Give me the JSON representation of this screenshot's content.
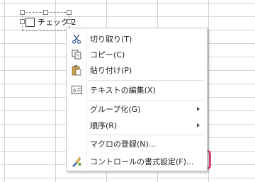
{
  "checkbox_control": {
    "label": "チェック 2",
    "checked": false
  },
  "context_menu": {
    "items": [
      {
        "label": "切り取り(T)",
        "icon": "scissors-icon"
      },
      {
        "label": "コピー(C)",
        "icon": "copy-icon"
      },
      {
        "label": "貼り付け(P)",
        "icon": "paste-icon"
      },
      {
        "label": "テキストの編集(X)",
        "icon": "edit-text-icon"
      },
      {
        "label": "グループ化(G)",
        "icon": "",
        "submenu": true
      },
      {
        "label": "順序(R)",
        "icon": "",
        "submenu": true
      },
      {
        "label": "マクロの登録(N)...",
        "icon": ""
      },
      {
        "label": "コントロールの書式設定(F)...",
        "icon": "format-control-icon",
        "highlighted": true
      }
    ]
  },
  "colors": {
    "highlight_border": "#e0447a",
    "highlight_fill": "#d2eee0",
    "grid": "#d4d4d4"
  }
}
